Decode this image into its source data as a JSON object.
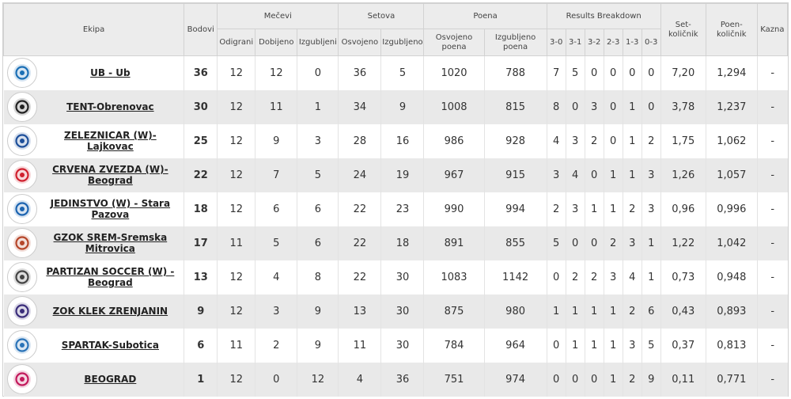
{
  "headers": {
    "team": "Ekipa",
    "points": "Bodovi",
    "matches": "Mečevi",
    "sets": "Setova",
    "poena": "Poena",
    "breakdown": "Results Breakdown",
    "set_ratio": "Set-količnik",
    "point_ratio": "Poen-količnik",
    "penalty": "Kazna",
    "played": "Odigrani",
    "won": "Dobijeno",
    "lost": "Izgubljeni",
    "sets_won": "Osvojeno",
    "sets_lost": "Izgubljeno",
    "pts_won": "Osvojeno poena",
    "pts_lost": "Izgubljeno poena",
    "r30": "3-0",
    "r31": "3-1",
    "r32": "3-2",
    "r23": "2-3",
    "r13": "1-3",
    "r03": "0-3"
  },
  "teams": [
    {
      "name": "UB - Ub",
      "logo": "ub-logo",
      "color": "#1b6fb5",
      "points": "36",
      "played": "12",
      "won": "12",
      "lost": "0",
      "sets_won": "36",
      "sets_lost": "5",
      "pts_won": "1020",
      "pts_lost": "788",
      "r30": "7",
      "r31": "5",
      "r32": "0",
      "r23": "0",
      "r13": "0",
      "r03": "0",
      "set_ratio": "7,20",
      "point_ratio": "1,294",
      "penalty": "-"
    },
    {
      "name": "TENT-Obrenovac",
      "logo": "tent-logo",
      "color": "#222222",
      "points": "30",
      "played": "12",
      "won": "11",
      "lost": "1",
      "sets_won": "34",
      "sets_lost": "9",
      "pts_won": "1008",
      "pts_lost": "815",
      "r30": "8",
      "r31": "0",
      "r32": "3",
      "r23": "0",
      "r13": "1",
      "r03": "0",
      "set_ratio": "3,78",
      "point_ratio": "1,237",
      "penalty": "-"
    },
    {
      "name": "ZELEZNICAR (W)-Lajkovac",
      "logo": "zeleznicar-logo",
      "color": "#1d4f9a",
      "points": "25",
      "played": "12",
      "won": "9",
      "lost": "3",
      "sets_won": "28",
      "sets_lost": "16",
      "pts_won": "986",
      "pts_lost": "928",
      "r30": "4",
      "r31": "3",
      "r32": "2",
      "r23": "0",
      "r13": "1",
      "r03": "2",
      "set_ratio": "1,75",
      "point_ratio": "1,062",
      "penalty": "-"
    },
    {
      "name": "CRVENA ZVEZDA (W)-Beograd",
      "logo": "crvena-zvezda-logo",
      "color": "#d0202e",
      "points": "22",
      "played": "12",
      "won": "7",
      "lost": "5",
      "sets_won": "24",
      "sets_lost": "19",
      "pts_won": "967",
      "pts_lost": "915",
      "r30": "3",
      "r31": "4",
      "r32": "0",
      "r23": "1",
      "r13": "1",
      "r03": "3",
      "set_ratio": "1,26",
      "point_ratio": "1,057",
      "penalty": "-"
    },
    {
      "name": "JEDINSTVO (W) - Stara Pazova",
      "logo": "jedinstvo-logo",
      "color": "#1b63b0",
      "points": "18",
      "played": "12",
      "won": "6",
      "lost": "6",
      "sets_won": "22",
      "sets_lost": "23",
      "pts_won": "990",
      "pts_lost": "994",
      "r30": "2",
      "r31": "3",
      "r32": "1",
      "r23": "1",
      "r13": "2",
      "r03": "3",
      "set_ratio": "0,96",
      "point_ratio": "0,996",
      "penalty": "-"
    },
    {
      "name": "GZOK SREM-Sremska Mitrovica",
      "logo": "gzok-srem-logo",
      "color": "#b5462a",
      "points": "17",
      "played": "11",
      "won": "5",
      "lost": "6",
      "sets_won": "22",
      "sets_lost": "18",
      "pts_won": "891",
      "pts_lost": "855",
      "r30": "5",
      "r31": "0",
      "r32": "0",
      "r23": "2",
      "r13": "3",
      "r03": "1",
      "set_ratio": "1,22",
      "point_ratio": "1,042",
      "penalty": "-"
    },
    {
      "name": "PARTIZAN SOCCER (W) - Beograd",
      "logo": "partizan-logo",
      "color": "#444444",
      "points": "13",
      "played": "12",
      "won": "4",
      "lost": "8",
      "sets_won": "22",
      "sets_lost": "30",
      "pts_won": "1083",
      "pts_lost": "1142",
      "r30": "0",
      "r31": "2",
      "r32": "2",
      "r23": "3",
      "r13": "4",
      "r03": "1",
      "set_ratio": "0,73",
      "point_ratio": "0,948",
      "penalty": "-"
    },
    {
      "name": "ZOK KLEK ZRENJANIN",
      "logo": "klek-logo",
      "color": "#3a2d7a",
      "points": "9",
      "played": "12",
      "won": "3",
      "lost": "9",
      "sets_won": "13",
      "sets_lost": "30",
      "pts_won": "875",
      "pts_lost": "980",
      "r30": "1",
      "r31": "1",
      "r32": "1",
      "r23": "1",
      "r13": "2",
      "r03": "6",
      "set_ratio": "0,43",
      "point_ratio": "0,893",
      "penalty": "-"
    },
    {
      "name": "SPARTAK-Subotica",
      "logo": "spartak-logo",
      "color": "#2a73b8",
      "points": "6",
      "played": "11",
      "won": "2",
      "lost": "9",
      "sets_won": "11",
      "sets_lost": "30",
      "pts_won": "784",
      "pts_lost": "964",
      "r30": "0",
      "r31": "1",
      "r32": "1",
      "r23": "1",
      "r13": "3",
      "r03": "5",
      "set_ratio": "0,37",
      "point_ratio": "0,813",
      "penalty": "-"
    },
    {
      "name": "BEOGRAD",
      "logo": "beograd-logo",
      "color": "#c2185b",
      "points": "1",
      "played": "12",
      "won": "0",
      "lost": "12",
      "sets_won": "4",
      "sets_lost": "36",
      "pts_won": "751",
      "pts_lost": "974",
      "r30": "0",
      "r31": "0",
      "r32": "0",
      "r23": "1",
      "r13": "2",
      "r03": "9",
      "set_ratio": "0,11",
      "point_ratio": "0,771",
      "penalty": "-"
    }
  ]
}
